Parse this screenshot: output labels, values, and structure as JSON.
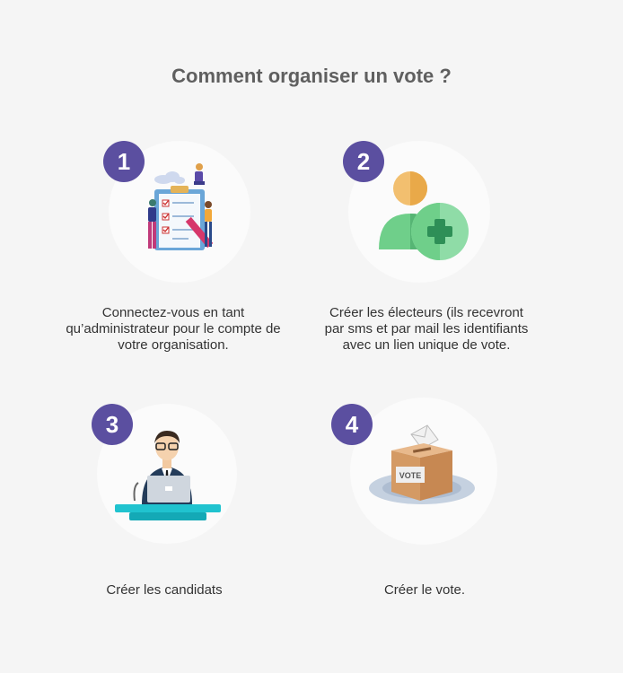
{
  "title": "Comment organiser un vote ?",
  "steps": [
    {
      "number": "1",
      "text": "Connectez-vous en tant qu’administrateur pour le compte de votre organisation."
    },
    {
      "number": "2",
      "text": "Créer les électeurs (ils recevront par sms et par mail les identifiants avec un lien unique de vote."
    },
    {
      "number": "3",
      "text": "Créer les candidats"
    },
    {
      "number": "4",
      "text": "Créer le vote."
    }
  ],
  "illustrations": {
    "ballot_box_label": "VOTE"
  },
  "colors": {
    "badge": "#5b4fa0",
    "title": "#5f5f5f",
    "circle_bg": "#fbfbfb"
  }
}
